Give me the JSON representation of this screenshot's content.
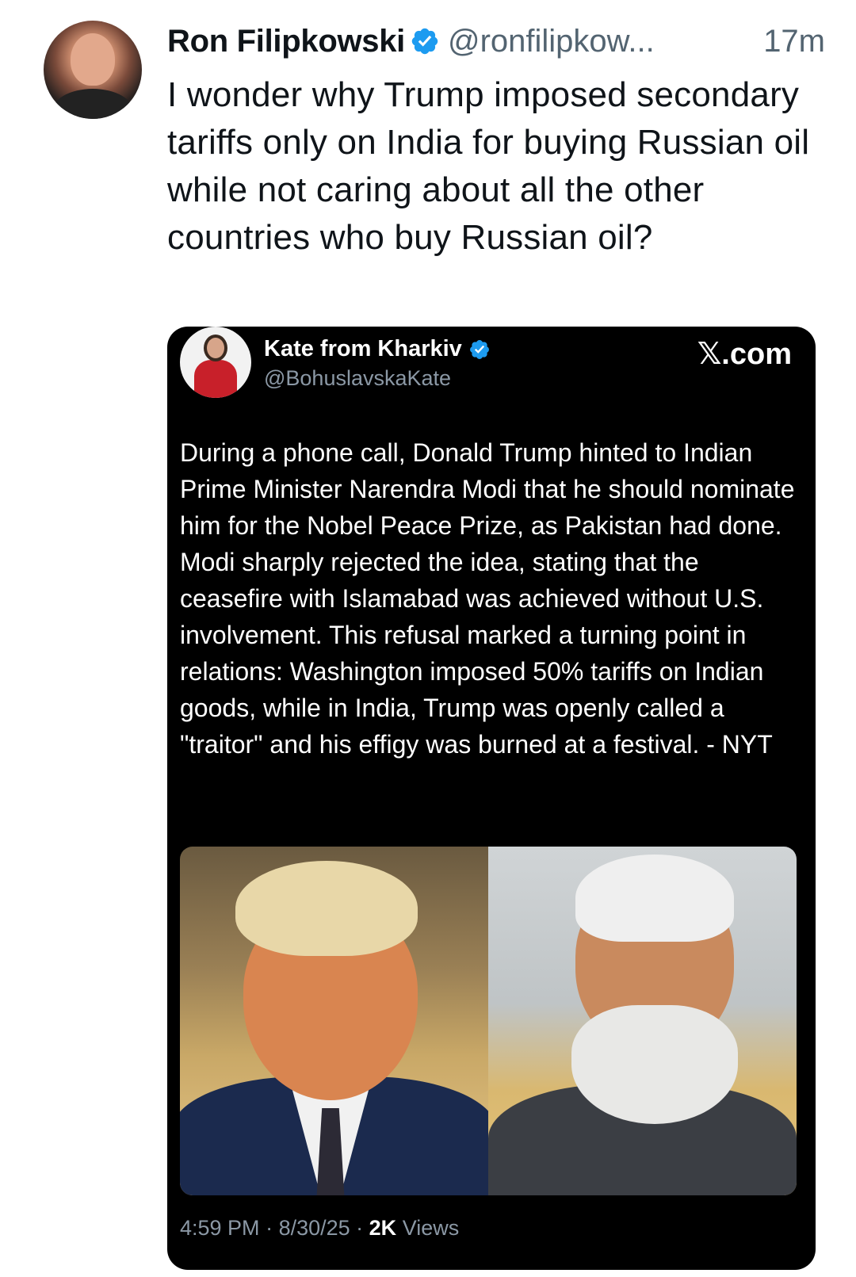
{
  "post": {
    "author_name": "Ron Filipkowski",
    "author_handle": "@ronfilipkow...",
    "time_ago": "17m",
    "text": "I wonder why Trump imposed secondary tariffs only on India for buying Russian oil while not caring about all the other countries who buy Russian oil?",
    "verified_icon": "verified-badge-icon",
    "accent_color": "#1d9bf0"
  },
  "embedded_post": {
    "author_name": "Kate from Kharkiv",
    "author_handle": "@BohuslavskaKate",
    "source": "𝕏.com",
    "text": "During a phone call, Donald Trump hinted to Indian Prime Minister Narendra Modi that he should nominate him for the Nobel Peace Prize, as Pakistan had done. Modi sharply rejected the idea, stating that the ceasefire with Islamabad was achieved without U.S. involvement. This refusal marked a turning point in relations: Washington imposed 50% tariffs on Indian goods, while in India, Trump was openly called a \"traitor\" and his effigy was burned at a festival. - NYT",
    "time": "4:59 PM",
    "date": "8/30/25",
    "views_count": "2K",
    "views_label": "Views",
    "separator": " · ",
    "background_color": "#000000"
  }
}
